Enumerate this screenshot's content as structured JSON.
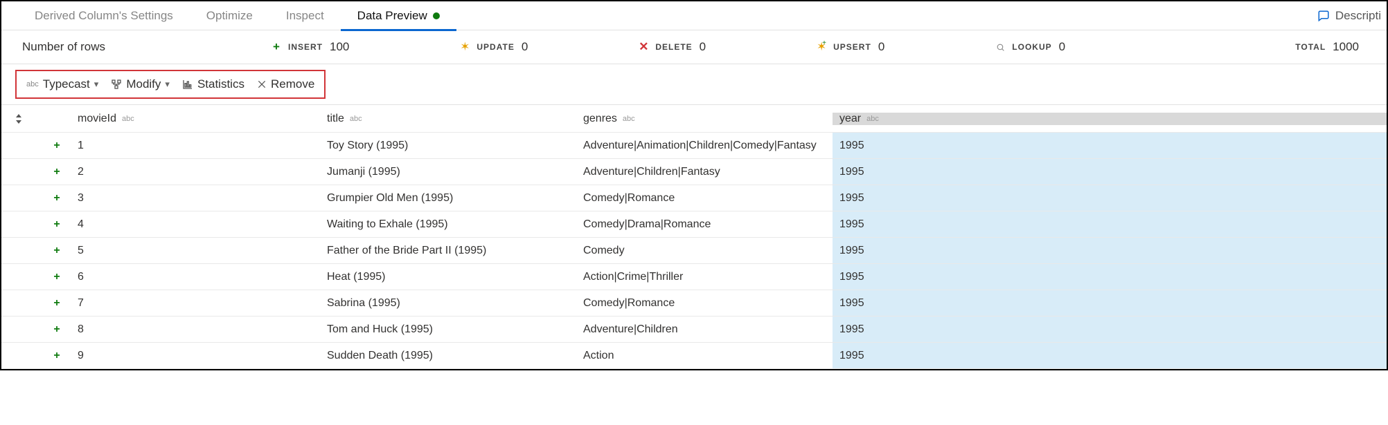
{
  "tabs": [
    {
      "label": "Derived Column's Settings",
      "active": false
    },
    {
      "label": "Optimize",
      "active": false
    },
    {
      "label": "Inspect",
      "active": false
    },
    {
      "label": "Data Preview",
      "active": true
    }
  ],
  "description_link": "Descripti",
  "stats": {
    "rows_label": "Number of rows",
    "insert": {
      "label": "INSERT",
      "value": "100"
    },
    "update": {
      "label": "UPDATE",
      "value": "0"
    },
    "delete": {
      "label": "DELETE",
      "value": "0"
    },
    "upsert": {
      "label": "UPSERT",
      "value": "0"
    },
    "lookup": {
      "label": "LOOKUP",
      "value": "0"
    },
    "total": {
      "label": "TOTAL",
      "value": "1000"
    }
  },
  "toolbar": {
    "typecast": "Typecast",
    "modify": "Modify",
    "statistics": "Statistics",
    "remove": "Remove"
  },
  "columns": {
    "movieId": {
      "label": "movieId",
      "type": "abc"
    },
    "title": {
      "label": "title",
      "type": "abc"
    },
    "genres": {
      "label": "genres",
      "type": "abc"
    },
    "year": {
      "label": "year",
      "type": "abc"
    }
  },
  "rows": [
    {
      "movieId": "1",
      "title": "Toy Story (1995)",
      "genres": "Adventure|Animation|Children|Comedy|Fantasy",
      "year": "1995"
    },
    {
      "movieId": "2",
      "title": "Jumanji (1995)",
      "genres": "Adventure|Children|Fantasy",
      "year": "1995"
    },
    {
      "movieId": "3",
      "title": "Grumpier Old Men (1995)",
      "genres": "Comedy|Romance",
      "year": "1995"
    },
    {
      "movieId": "4",
      "title": "Waiting to Exhale (1995)",
      "genres": "Comedy|Drama|Romance",
      "year": "1995"
    },
    {
      "movieId": "5",
      "title": "Father of the Bride Part II (1995)",
      "genres": "Comedy",
      "year": "1995"
    },
    {
      "movieId": "6",
      "title": "Heat (1995)",
      "genres": "Action|Crime|Thriller",
      "year": "1995"
    },
    {
      "movieId": "7",
      "title": "Sabrina (1995)",
      "genres": "Comedy|Romance",
      "year": "1995"
    },
    {
      "movieId": "8",
      "title": "Tom and Huck (1995)",
      "genres": "Adventure|Children",
      "year": "1995"
    },
    {
      "movieId": "9",
      "title": "Sudden Death (1995)",
      "genres": "Action",
      "year": "1995"
    }
  ]
}
